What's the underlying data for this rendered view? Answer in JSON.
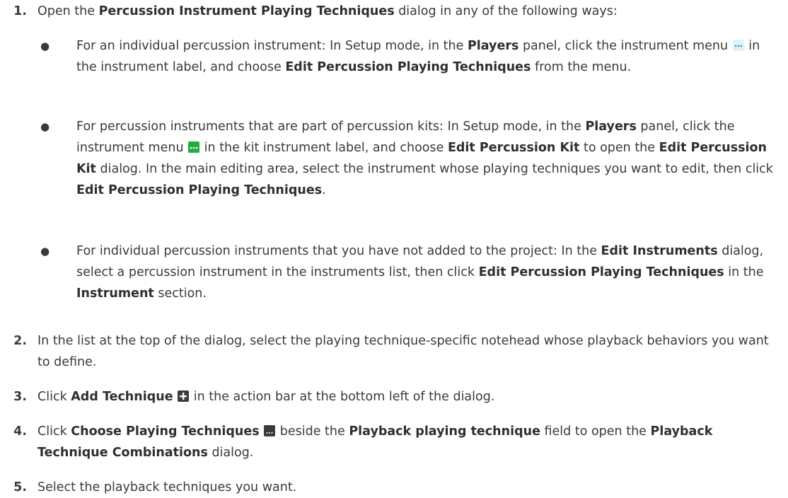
{
  "steps": [
    {
      "num": "1.",
      "parts": [
        "Open the ",
        "Percussion Instrument Playing Techniques",
        " dialog in any of the following ways:"
      ],
      "bullets": [
        {
          "parts": [
            "For an individual percussion instrument: In Setup mode, in the ",
            "Players",
            " panel, click the instrument menu ",
            " in the instrument label, and choose ",
            "Edit Percussion Playing Techniques",
            " from the menu."
          ]
        },
        {
          "parts": [
            "For percussion instruments that are part of percussion kits: In Setup mode, in the ",
            "Players",
            " panel, click the instrument menu ",
            " in the kit instrument label, and choose ",
            "Edit Percussion Kit",
            " to open the ",
            "Edit Percussion Kit",
            " dialog. In the main editing area, select the instrument whose playing techniques you want to edit, then click ",
            "Edit Percussion Playing Techniques",
            "."
          ]
        },
        {
          "parts": [
            "For individual percussion instruments that you have not added to the project: In the ",
            "Edit Instruments",
            " dialog, select a percussion instrument in the instruments list, then click ",
            "Edit Percussion Playing Techniques",
            " in the ",
            "Instrument",
            " section."
          ]
        }
      ]
    },
    {
      "num": "2.",
      "parts": [
        "In the list at the top of the dialog, select the playing technique-specific notehead whose playback behaviors you want to define."
      ]
    },
    {
      "num": "3.",
      "parts": [
        "Click ",
        "Add Technique",
        " in the action bar at the bottom left of the dialog."
      ]
    },
    {
      "num": "4.",
      "parts": [
        "Click ",
        "Choose Playing Techniques",
        " beside the ",
        "Playback playing technique",
        " field to open the ",
        "Playback Technique Combinations",
        " dialog."
      ]
    },
    {
      "num": "5.",
      "parts": [
        "Select the playback techniques you want."
      ]
    }
  ],
  "bullet_glyph": "●",
  "icons": {
    "instrument_menu_light": {
      "name": "more-menu-icon",
      "bg": "#e3f1f8",
      "fg": "#2a9fd6"
    },
    "instrument_menu_green": {
      "name": "more-menu-icon",
      "bg": "#1fae3c",
      "fg": "#ffffff"
    },
    "add": {
      "name": "plus-icon",
      "bg": "#3b3b3b",
      "fg": "#ffffff"
    },
    "choose": {
      "name": "ellipsis-icon",
      "bg": "#3b3b3b",
      "fg": "#ffffff"
    }
  }
}
